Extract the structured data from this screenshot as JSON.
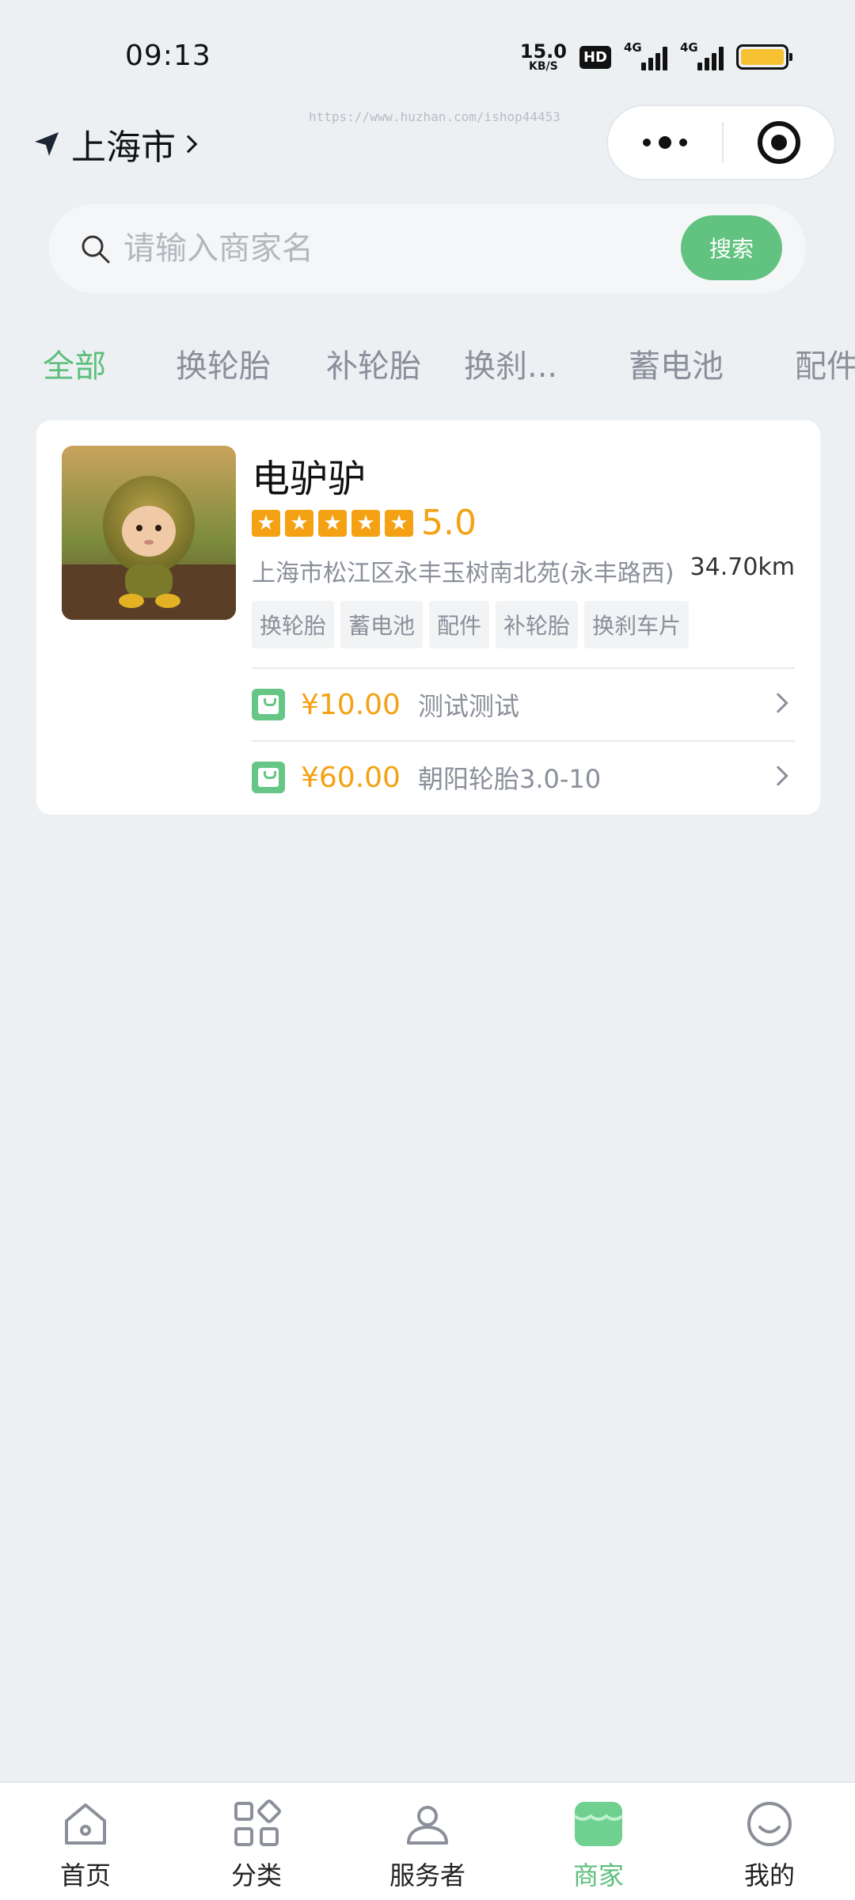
{
  "status_bar": {
    "time": "09:13",
    "net_speed_value": "15.0",
    "net_speed_unit": "KB/S",
    "hd_label": "HD",
    "signal1_label": "4G",
    "signal2_label": "4G",
    "battery_color": "#f6c232"
  },
  "header": {
    "location_icon": "navigation-arrow-icon",
    "city": "上海市",
    "watermark": "https://www.huzhan.com/ishop44453"
  },
  "search": {
    "placeholder": "请输入商家名",
    "value": "",
    "button_label": "搜索"
  },
  "tabs": [
    {
      "label": "全部",
      "active": true
    },
    {
      "label": "换轮胎",
      "active": false
    },
    {
      "label": "补轮胎",
      "active": false
    },
    {
      "label": "换刹...",
      "active": false
    },
    {
      "label": "蓄电池",
      "active": false
    },
    {
      "label": "配件",
      "active": false
    }
  ],
  "shops": [
    {
      "name": "电驴驴",
      "rating_stars": 5,
      "score": "5.0",
      "address": "上海市松江区永丰玉树南北苑(永丰路西)",
      "distance": "34.70km",
      "tags": [
        "换轮胎",
        "蓄电池",
        "配件",
        "补轮胎",
        "换刹车片"
      ],
      "deals": [
        {
          "price": "¥10.00",
          "name": "测试测试"
        },
        {
          "price": "¥60.00",
          "name": "朝阳轮胎3.0-10"
        }
      ]
    }
  ],
  "tabbar": [
    {
      "label": "首页",
      "icon": "home-icon",
      "active": false
    },
    {
      "label": "分类",
      "icon": "category-grid-icon",
      "active": false
    },
    {
      "label": "服务者",
      "icon": "person-icon",
      "active": false
    },
    {
      "label": "商家",
      "icon": "shop-icon",
      "active": true
    },
    {
      "label": "我的",
      "icon": "smile-profile-icon",
      "active": false
    }
  ],
  "colors": {
    "accent_green": "#5cbf7b",
    "price_orange": "#f4a214",
    "background": "#edf0f3"
  }
}
